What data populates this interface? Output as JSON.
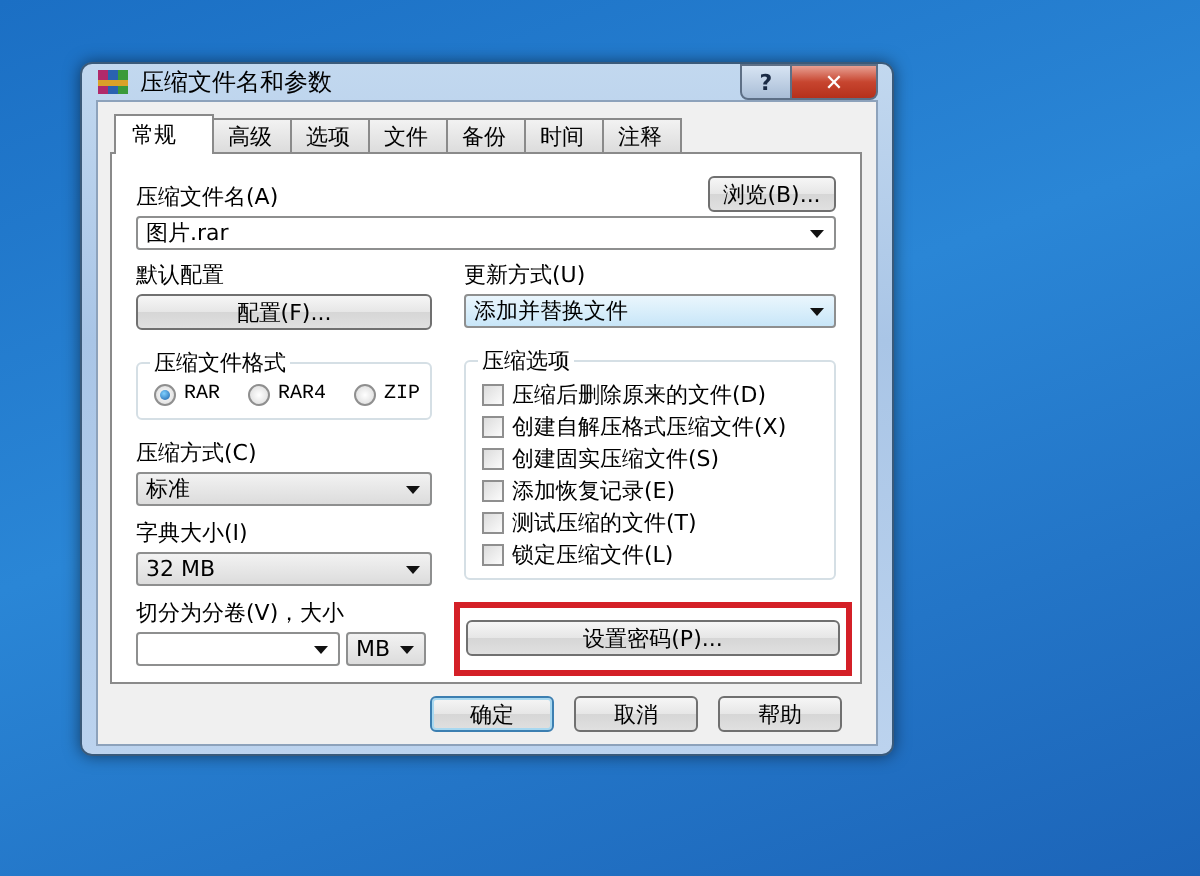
{
  "window": {
    "title": "压缩文件名和参数",
    "help_button": "?",
    "close_button": "✕"
  },
  "tabs": [
    {
      "label": "常规",
      "selected": true
    },
    {
      "label": "高级",
      "selected": false
    },
    {
      "label": "选项",
      "selected": false
    },
    {
      "label": "文件",
      "selected": false
    },
    {
      "label": "备份",
      "selected": false
    },
    {
      "label": "时间",
      "selected": false
    },
    {
      "label": "注释",
      "selected": false
    }
  ],
  "archive_name": {
    "label": "压缩文件名(A)",
    "value": "图片.rar",
    "browse_button": "浏览(B)..."
  },
  "profiles": {
    "label": "默认配置",
    "button": "配置(F)..."
  },
  "update_mode": {
    "label": "更新方式(U)",
    "value": "添加并替换文件"
  },
  "archive_format": {
    "title": "压缩文件格式",
    "options": [
      {
        "label": "RAR",
        "selected": true
      },
      {
        "label": "RAR4",
        "selected": false
      },
      {
        "label": "ZIP",
        "selected": false
      }
    ]
  },
  "compression_method": {
    "label": "压缩方式(C)",
    "value": "标准"
  },
  "dictionary_size": {
    "label": "字典大小(I)",
    "value": "32 MB"
  },
  "split_volumes": {
    "label": "切分为分卷(V)，大小",
    "unit": "MB"
  },
  "archive_options": {
    "title": "压缩选项",
    "items": [
      {
        "label": "压缩后删除原来的文件(D)",
        "checked": false
      },
      {
        "label": "创建自解压格式压缩文件(X)",
        "checked": false
      },
      {
        "label": "创建固实压缩文件(S)",
        "checked": false
      },
      {
        "label": "添加恢复记录(E)",
        "checked": false
      },
      {
        "label": "测试压缩的文件(T)",
        "checked": false
      },
      {
        "label": "锁定压缩文件(L)",
        "checked": false
      }
    ]
  },
  "password_button": {
    "label": "设置密码(P)...",
    "highlighted": true
  },
  "buttons": [
    {
      "label": "确定",
      "default": true
    },
    {
      "label": "取消",
      "default": false
    },
    {
      "label": "帮助",
      "default": false
    }
  ]
}
